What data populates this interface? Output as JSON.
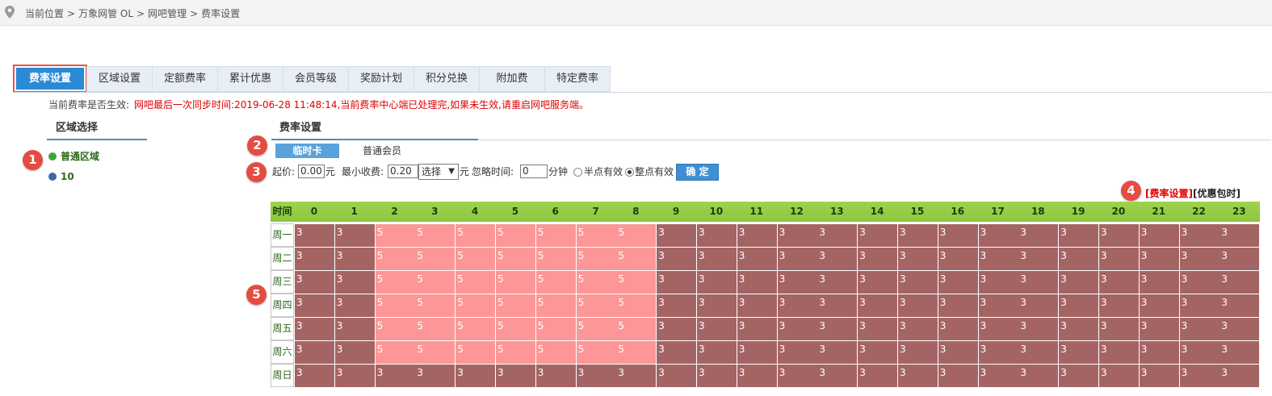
{
  "breadcrumb": {
    "label": "当前位置",
    "items": [
      "万象网管 OL",
      "网吧管理",
      "费率设置"
    ]
  },
  "tabs": [
    "费率设置",
    "区域设置",
    "定额费率",
    "累计优惠",
    "会员等级",
    "奖励计划",
    "积分兑换",
    "附加费",
    "特定费率"
  ],
  "notice": {
    "label": "当前费率是否生效:",
    "message": "网吧最后一次同步时间:2019-06-28 11:48:14,当前费率中心端已处理完,如果未生效,请重启网吧服务端。"
  },
  "area_panel": {
    "title": "区域选择",
    "items": [
      {
        "label": "普通区域",
        "color": "#3aa63a"
      },
      {
        "label": "10",
        "color": "#3b6aa8"
      }
    ]
  },
  "rate_panel": {
    "title": "费率设置",
    "subtabs": [
      "临时卡",
      "普通会员"
    ],
    "form": {
      "start_price_label": "起价:",
      "start_price_value": "0.00",
      "yuan": "元",
      "min_charge_label": "最小收费:",
      "min_charge_value": "0.20",
      "select_value": "选择",
      "ignore_label": "忽略时间:",
      "ignore_value": "0",
      "minute": "分钟",
      "half_hour": "半点有效",
      "full_hour": "整点有效",
      "confirm": "确 定"
    },
    "links": {
      "rate": "[费率设置]",
      "package": "[优惠包时]"
    }
  },
  "badges": [
    "1",
    "2",
    "3",
    "4",
    "5"
  ],
  "colors": {
    "header_green": "#8cc63e",
    "cell_normal": "#a56464",
    "cell_peak": "#fd9797",
    "accent_blue": "#2a8ad6",
    "badge_red": "#e54b3f"
  },
  "rate_grid": {
    "corner": "时间",
    "hours": [
      "0",
      "1",
      "2",
      "3",
      "4",
      "5",
      "6",
      "7",
      "8",
      "9",
      "10",
      "11",
      "12",
      "13",
      "14",
      "15",
      "16",
      "17",
      "18",
      "19",
      "20",
      "21",
      "22",
      "23"
    ],
    "days": [
      "周一",
      "周二",
      "周三",
      "周四",
      "周五",
      "周六",
      "周日"
    ],
    "rows": [
      [
        "3",
        "3",
        "5",
        "5",
        "5",
        "5",
        "5",
        "5",
        "5",
        "3",
        "3",
        "3",
        "3",
        "3",
        "3",
        "3",
        "3",
        "3",
        "3",
        "3",
        "3",
        "3",
        "3",
        "3"
      ],
      [
        "3",
        "3",
        "5",
        "5",
        "5",
        "5",
        "5",
        "5",
        "5",
        "3",
        "3",
        "3",
        "3",
        "3",
        "3",
        "3",
        "3",
        "3",
        "3",
        "3",
        "3",
        "3",
        "3",
        "3"
      ],
      [
        "3",
        "3",
        "5",
        "5",
        "5",
        "5",
        "5",
        "5",
        "5",
        "3",
        "3",
        "3",
        "3",
        "3",
        "3",
        "3",
        "3",
        "3",
        "3",
        "3",
        "3",
        "3",
        "3",
        "3"
      ],
      [
        "3",
        "3",
        "5",
        "5",
        "5",
        "5",
        "5",
        "5",
        "5",
        "3",
        "3",
        "3",
        "3",
        "3",
        "3",
        "3",
        "3",
        "3",
        "3",
        "3",
        "3",
        "3",
        "3",
        "3"
      ],
      [
        "3",
        "3",
        "5",
        "5",
        "5",
        "5",
        "5",
        "5",
        "5",
        "3",
        "3",
        "3",
        "3",
        "3",
        "3",
        "3",
        "3",
        "3",
        "3",
        "3",
        "3",
        "3",
        "3",
        "3"
      ],
      [
        "3",
        "3",
        "5",
        "5",
        "5",
        "5",
        "5",
        "5",
        "5",
        "3",
        "3",
        "3",
        "3",
        "3",
        "3",
        "3",
        "3",
        "3",
        "3",
        "3",
        "3",
        "3",
        "3",
        "3"
      ],
      [
        "3",
        "3",
        "3",
        "3",
        "3",
        "3",
        "3",
        "3",
        "3",
        "3",
        "3",
        "3",
        "3",
        "3",
        "3",
        "3",
        "3",
        "3",
        "3",
        "3",
        "3",
        "3",
        "3",
        "3"
      ]
    ]
  }
}
